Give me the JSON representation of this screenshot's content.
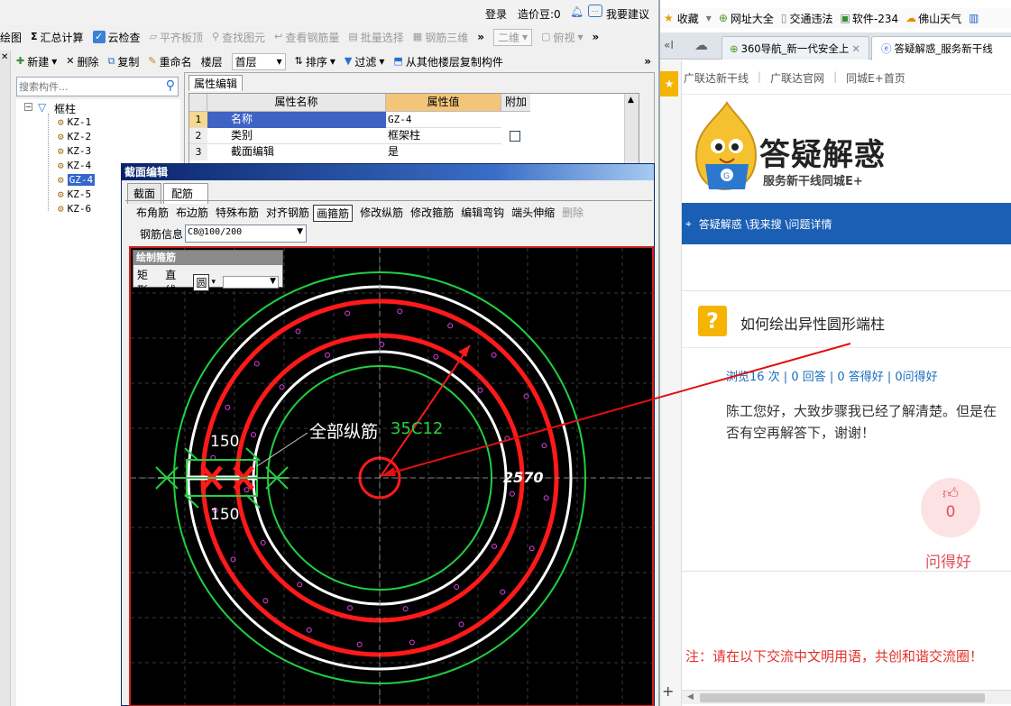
{
  "left": {
    "topbar": {
      "login": "登录",
      "cost_beans_label": "造价豆:0",
      "feedback": "我要建议"
    },
    "toolbar1": [
      {
        "label": "绘图",
        "icon": "draw-icon",
        "disabled": false
      },
      {
        "label": "汇总计算",
        "icon": "sigma-icon",
        "disabled": false
      },
      {
        "label": "云检查",
        "icon": "cloud-check-icon",
        "disabled": false
      },
      {
        "label": "平齐板顶",
        "icon": "align-icon",
        "disabled": true
      },
      {
        "label": "查找图元",
        "icon": "find-icon",
        "disabled": true
      },
      {
        "label": "查看钢筋量",
        "icon": "rebar-view-icon",
        "disabled": true
      },
      {
        "label": "批量选择",
        "icon": "batch-icon",
        "disabled": true
      },
      {
        "label": "钢筋三维",
        "icon": "3d-icon",
        "disabled": true
      }
    ],
    "view_2d": "二维",
    "view_mode": "俯视",
    "toolbar2": {
      "new": "新建",
      "delete": "删除",
      "copy": "复制",
      "rename": "重命名",
      "floor_label": "楼层",
      "floor_value": "首层",
      "sort": "排序",
      "filter": "过滤",
      "copy_from_floor": "从其他楼层复制构件"
    },
    "search_placeholder": "搜索构件...",
    "tree": {
      "root": "框柱",
      "items": [
        "KZ-1",
        "KZ-2",
        "KZ-3",
        "KZ-4",
        "GZ-4",
        "KZ-5",
        "KZ-6"
      ],
      "selected_index": 4
    },
    "property_panel": {
      "tab": "属性编辑",
      "headers": [
        "属性名称",
        "属性值",
        "附加"
      ],
      "rows": [
        {
          "num": "1",
          "name": "名称",
          "value": "GZ-4",
          "checkbox": false
        },
        {
          "num": "2",
          "name": "类别",
          "value": "框架柱",
          "checkbox": true
        },
        {
          "num": "3",
          "name": "截面编辑",
          "value": "是",
          "checkbox": false
        }
      ]
    },
    "section_editor": {
      "title": "截面编辑",
      "tabs": [
        "截面",
        "配筋"
      ],
      "active_tab": 1,
      "actions": [
        "布角筋",
        "布边筋",
        "特殊布筋",
        "对齐钢筋",
        "画箍筋",
        "修改纵筋",
        "修改箍筋",
        "编辑弯钩",
        "端头伸缩",
        "删除"
      ],
      "active_action": 4,
      "rebar_info_label": "钢筋信息",
      "rebar_info_value": "C8@100/200",
      "draw_stirrup": {
        "title": "绘制箍筋",
        "shapes": [
          "矩形",
          "直线",
          "圆"
        ],
        "selected": "圆"
      },
      "canvas": {
        "label_top": "150",
        "label_bottom": "150",
        "all_longitudinal": "全部纵筋",
        "long_value": "35C12",
        "diameter": "2570"
      }
    }
  },
  "right": {
    "bookmarks": [
      "收藏",
      "网址大全",
      "交通违法",
      "软件-234",
      "佛山天气"
    ],
    "tabs": [
      "360导航_新一代安全上",
      "答疑解惑_服务新干线"
    ],
    "breadcrumb_links": [
      "广联达新干线",
      "广联达官网",
      "同城E+首页"
    ],
    "logo_title": "答疑解惑",
    "logo_subtitle": "服务新干线同城E+",
    "nav_path": "答疑解惑 \\我来搜 \\问题详情",
    "question_title": "如何绘出异性圆形端柱",
    "stats": "浏览16 次 | 0 回答 | 0 答得好 | 0问得好",
    "body_line1": "陈工您好，大致步骤我已经了解清楚。但是在",
    "body_line2": "否有空再解答下，谢谢！",
    "like_count": "0",
    "like_label": "问得好",
    "notice": "注：请在以下交流中文明用语，共创和谐交流圈！",
    "colors": {
      "nav_bg": "#1a5fb4",
      "notice": "#e0322b",
      "link": "#1a6dbf",
      "like_bg": "#fde2e4"
    }
  }
}
